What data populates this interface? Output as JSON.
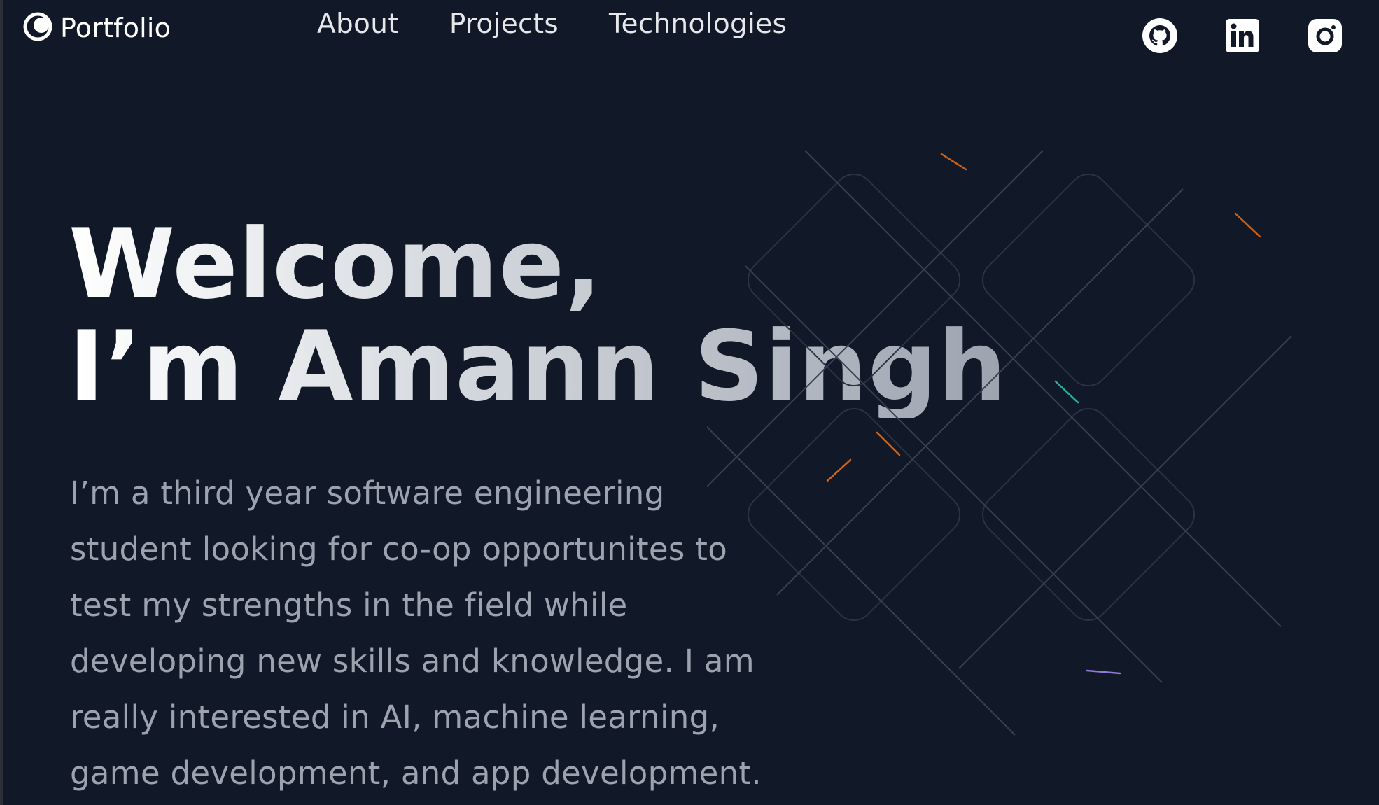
{
  "header": {
    "brand_label": "Portfolio",
    "nav": [
      {
        "label": "About"
      },
      {
        "label": "Projects"
      },
      {
        "label": "Technologies"
      }
    ],
    "socials": [
      {
        "icon": "github-icon"
      },
      {
        "icon": "linkedin-icon"
      },
      {
        "icon": "instagram-icon"
      }
    ]
  },
  "hero": {
    "title_line1": "Welcome,",
    "title_line2": "I’m Amann Singh",
    "description": "I’m a third year software engineering student looking for co-op opportunites to test my strengths in the field while developing new skills and knowledge. I am really interested in AI, machine learning, game development, and app development."
  },
  "colors": {
    "background": "#111827",
    "text": "#e5e7eb",
    "muted_text": "#9ca3af",
    "accent_orange": "#f97316",
    "accent_teal": "#2dd4bf",
    "accent_purple": "#a78bfa"
  }
}
